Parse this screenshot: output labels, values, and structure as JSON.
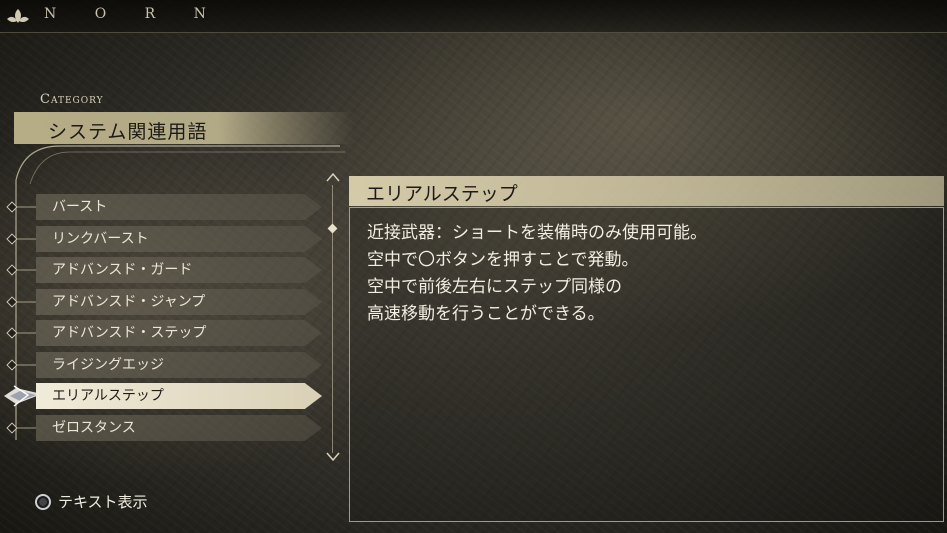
{
  "top_bar": {
    "brand": "N O R N",
    "logo_icon": "norn-leaf-icon"
  },
  "category": {
    "label": "Category",
    "title": "システム関連用語"
  },
  "list": {
    "items": [
      {
        "label": "バースト",
        "selected": false
      },
      {
        "label": "リンクバースト",
        "selected": false
      },
      {
        "label": "アドバンスド・ガード",
        "selected": false
      },
      {
        "label": "アドバンスド・ジャンプ",
        "selected": false
      },
      {
        "label": "アドバンスド・ステップ",
        "selected": false
      },
      {
        "label": "ライジングエッジ",
        "selected": false
      },
      {
        "label": "エリアルステップ",
        "selected": true
      },
      {
        "label": "ゼロスタンス",
        "selected": false
      }
    ],
    "scroll_up_icon": "arrow-up-icon",
    "scroll_down_icon": "arrow-down-icon"
  },
  "detail": {
    "title": "エリアルステップ",
    "lines": [
      "近接武器：ショートを装備時のみ使用可能。",
      "空中で〇ボタンを押すことで発動。",
      "空中で前後左右にステップ同様の",
      "高速移動を行うことができる。"
    ]
  },
  "footer": {
    "hint_icon": "circle-button-icon",
    "hint_label": "テキスト表示"
  },
  "colors": {
    "selected_bg": "#f1ebd9",
    "header_bg": "#dcd2af",
    "text": "#f1ece0"
  }
}
